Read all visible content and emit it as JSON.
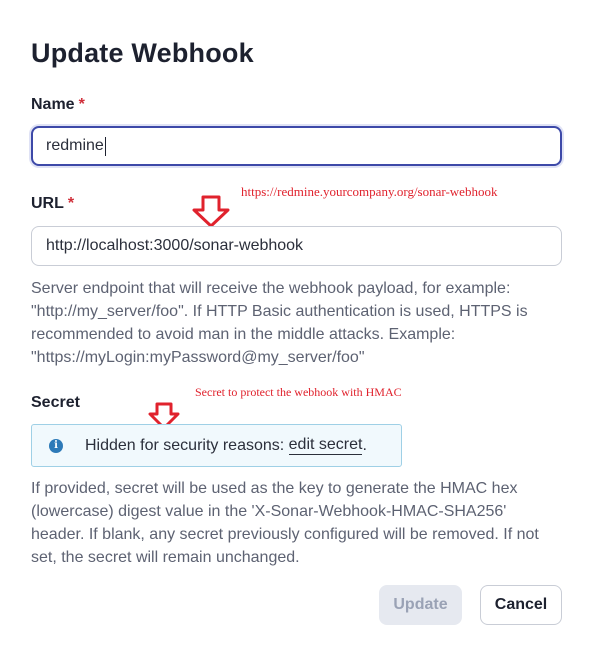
{
  "dialog": {
    "title": "Update Webhook",
    "required_mark": "*"
  },
  "name_field": {
    "label": "Name",
    "value": "redmine"
  },
  "url_field": {
    "label": "URL",
    "value": "http://localhost:3000/sonar-webhook",
    "help": "Server endpoint that will receive the webhook payload, for example: \"http://my_server/foo\". If HTTP Basic authentication is used, HTTPS is recommended to avoid man in the middle attacks. Example: \"https://myLogin:myPassword@my_server/foo\"",
    "annotation": "https://redmine.yourcompany.org/sonar-webhook"
  },
  "secret_field": {
    "label": "Secret",
    "info_text": "Hidden for security reasons: ",
    "edit_link": "edit secret",
    "info_suffix": ".",
    "help": "If provided, secret will be used as the key to generate the HMAC hex (lowercase) digest value in the 'X-Sonar-Webhook-HMAC-SHA256' header. If blank, any secret previously configured will be removed. If not set, the secret will remain unchanged.",
    "annotation": "Secret to protect the webhook with HMAC"
  },
  "buttons": {
    "update": "Update",
    "cancel": "Cancel"
  },
  "icons": {
    "info": "info-icon",
    "annotation_arrow": "down-arrow-icon"
  },
  "colors": {
    "annotation": "#e0222d",
    "focus_border": "#3d49a8",
    "info_border": "#9fd0e6"
  }
}
